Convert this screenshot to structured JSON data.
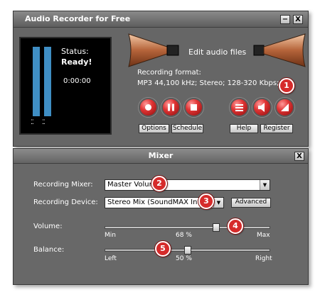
{
  "recorder": {
    "title": "Audio Recorder for Free",
    "minimize_label": "−",
    "close_label": "X",
    "meter_channel_left": "⁚⁚",
    "meter_channel_right": "⁚⁚",
    "status_label": "Status:",
    "status_value": "Ready!",
    "timer": "0:00:00",
    "edit_files_label": "Edit audio files",
    "format_label": "Recording format:",
    "format_value": "MP3 44,100 kHz; Stereo;  128-320 Kbps;",
    "buttons": {
      "options": "Options",
      "schedule": "Schedule",
      "help": "Help",
      "register": "Register"
    }
  },
  "mixer": {
    "title": "Mixer",
    "close_label": "X",
    "recording_mixer_label": "Recording Mixer:",
    "recording_mixer_value": "Master Volume",
    "recording_device_label": "Recording Device:",
    "recording_device_value": "Stereo Mix (SoundMAX Integrated",
    "advanced_label": "Advanced",
    "volume": {
      "label": "Volume:",
      "min_label": "Min",
      "max_label": "Max",
      "value_label": "68 %",
      "value": 68
    },
    "balance": {
      "label": "Balance:",
      "left_label": "Left",
      "right_label": "Right",
      "value_label": "50 %",
      "value": 50
    }
  },
  "callouts": [
    "1",
    "2",
    "3",
    "4",
    "5"
  ],
  "colors": {
    "record_button": "#e03434",
    "meter_bar": "#3f8ec4",
    "callout": "#d62b2b"
  }
}
